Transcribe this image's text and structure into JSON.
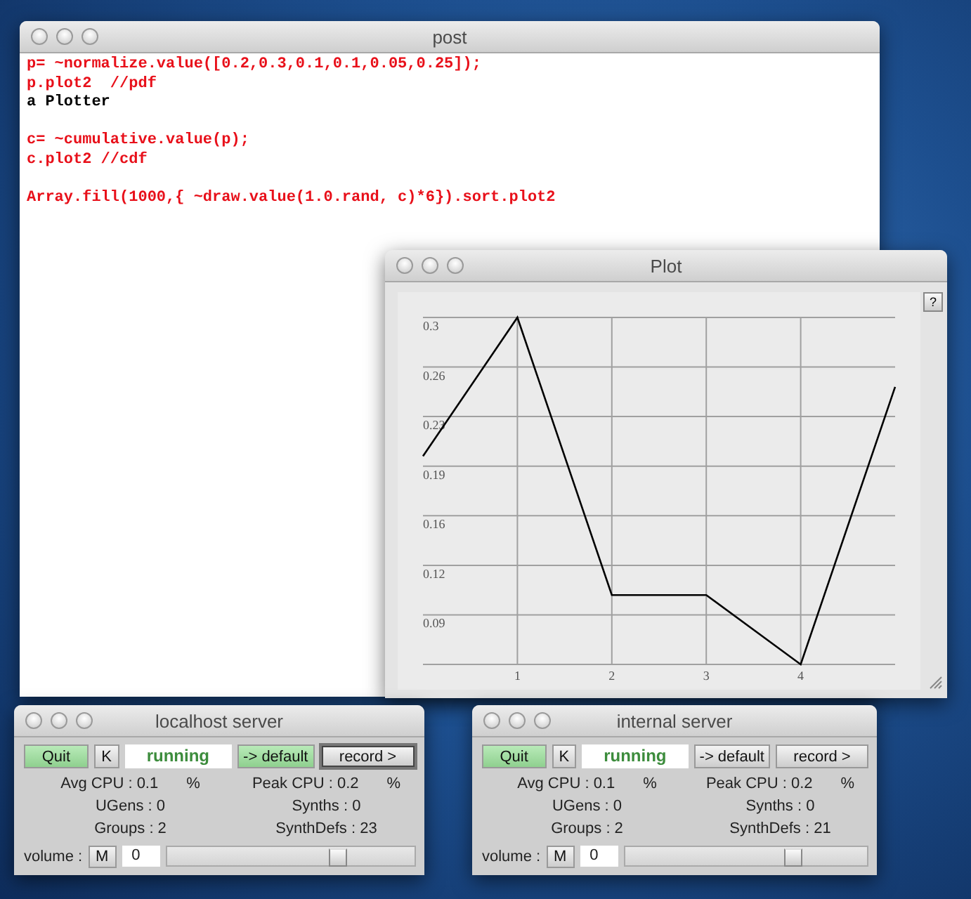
{
  "post_window": {
    "title": "post",
    "blocks": [
      [
        {
          "kind": "code",
          "text": "p= ~normalize.value([0.2,0.3,0.1,0.1,0.05,0.25]);"
        },
        {
          "kind": "code",
          "text": "p.plot2  //pdf"
        },
        {
          "kind": "output",
          "text": "a Plotter"
        }
      ],
      [
        {
          "kind": "code",
          "text": "c= ~cumulative.value(p);"
        },
        {
          "kind": "code",
          "text": "c.plot2 //cdf"
        }
      ],
      [
        {
          "kind": "code",
          "text": "Array.fill(1000,{ ~draw.value(1.0.rand, c)*6}).sort.plot2"
        }
      ]
    ]
  },
  "plot_window": {
    "title": "Plot",
    "help_button": "?",
    "chart_data": {
      "type": "line",
      "x": [
        0,
        1,
        2,
        3,
        4,
        5
      ],
      "grid": true,
      "series": [
        {
          "color": "#000000",
          "values": [
            0.2,
            0.3,
            0.1,
            0.1,
            0.05,
            0.25
          ]
        }
      ],
      "xlim": [
        0,
        5
      ],
      "ylim": [
        0.05,
        0.3
      ],
      "xticks": [
        1,
        2,
        3,
        4
      ],
      "yticks": [
        {
          "value": 0.0857,
          "label": "0.09"
        },
        {
          "value": 0.1214,
          "label": "0.12"
        },
        {
          "value": 0.1571,
          "label": "0.16"
        },
        {
          "value": 0.1929,
          "label": "0.19"
        },
        {
          "value": 0.2286,
          "label": "0.23"
        },
        {
          "value": 0.2643,
          "label": "0.26"
        },
        {
          "value": 0.3,
          "label": "0.3"
        }
      ]
    }
  },
  "servers": [
    {
      "title": "localhost server",
      "quit": {
        "label": "Quit",
        "highlighted": true
      },
      "kill": "K",
      "status": "running",
      "default_button": {
        "label": "-> default",
        "highlighted": true
      },
      "record_button": {
        "label": "record >",
        "focused": true
      },
      "stats": [
        {
          "text": "Avg CPU : 0.1",
          "unit": "%"
        },
        {
          "text": "Peak CPU : 0.2",
          "unit": "%"
        },
        {
          "text": "UGens : 0"
        },
        {
          "text": "Synths : 0"
        },
        {
          "text": "Groups : 2"
        },
        {
          "text": "SynthDefs : 23"
        }
      ],
      "volume": {
        "label": "volume :",
        "mute": "M",
        "value": "0",
        "level": 0.69
      }
    },
    {
      "title": "internal server",
      "quit": {
        "label": "Quit",
        "highlighted": true
      },
      "kill": "K",
      "status": "running",
      "default_button": {
        "label": "-> default",
        "highlighted": false
      },
      "record_button": {
        "label": "record >",
        "focused": false
      },
      "stats": [
        {
          "text": "Avg CPU : 0.1",
          "unit": "%"
        },
        {
          "text": "Peak CPU : 0.2",
          "unit": "%"
        },
        {
          "text": "UGens : 0"
        },
        {
          "text": "Synths : 0"
        },
        {
          "text": "Groups : 2"
        },
        {
          "text": "SynthDefs : 21"
        }
      ],
      "volume": {
        "label": "volume :",
        "mute": "M",
        "value": "0",
        "level": 0.69
      }
    }
  ]
}
